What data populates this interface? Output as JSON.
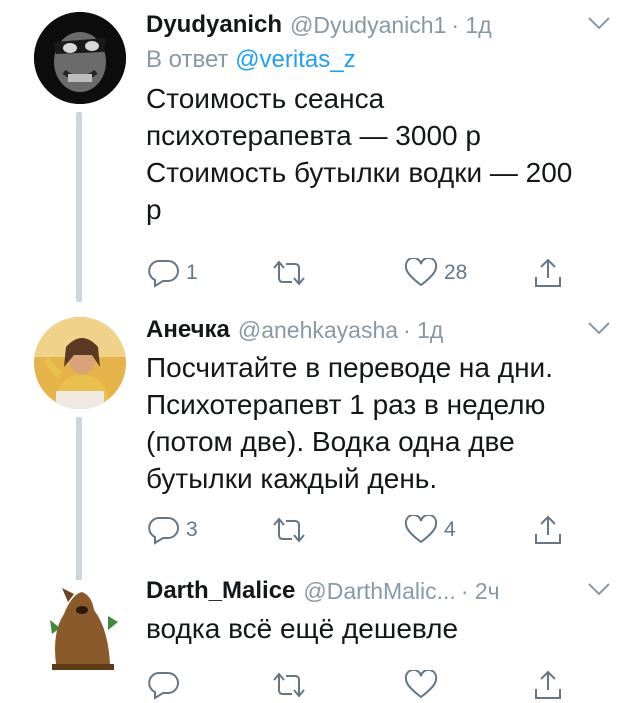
{
  "tweets": [
    {
      "name": "Dyudyanich",
      "handle": "@Dyudyanich1",
      "time": "· 1д",
      "reply_label": "В ответ",
      "reply_to": "@veritas_z",
      "lines": [
        "Стоимость сеанса",
        "психотерапевта — 3000 р",
        "Стоимость бутылки водки — 200",
        "р"
      ],
      "replies": "1",
      "retweets": "",
      "likes": "28"
    },
    {
      "name": "Анечка",
      "handle": "@anehkayasha",
      "time": "· 1д",
      "lines": [
        "Посчитайте в переводе на дни.",
        "Психотерапевт 1 раз в неделю",
        "(потом две). Водка одна две",
        "бутылки каждый день."
      ],
      "replies": "3",
      "retweets": "",
      "likes": "4"
    },
    {
      "name": "Darth_Malice",
      "handle": "@DarthMalic...",
      "time": "· 2ч",
      "lines": [
        "водка всё ещё дешевле"
      ],
      "replies": "",
      "retweets": "",
      "likes": ""
    }
  ],
  "colors": {
    "accent": "#1da1f2",
    "secondary": "#8899a6",
    "thread_line": "#ccd6dd"
  },
  "icons": [
    "reply-icon",
    "retweet-icon",
    "like-icon",
    "share-icon",
    "caret-down-icon"
  ]
}
